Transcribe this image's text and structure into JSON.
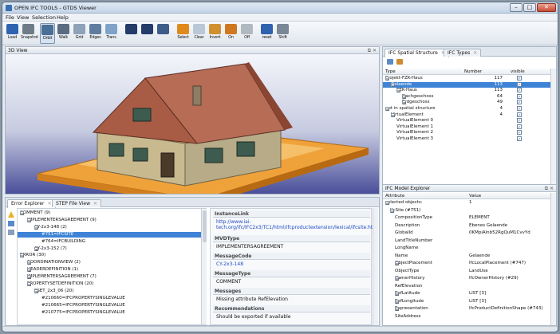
{
  "window": {
    "title": "OPEN IFC TOOLS - GTDS Viewer",
    "min_label": "–",
    "max_label": "□",
    "close_label": "✕"
  },
  "menu": [
    "File",
    "View",
    "Selection",
    "Help"
  ],
  "toolbar": [
    {
      "label": "Load",
      "icon": "folder-icon",
      "color": "#2f63b0"
    },
    {
      "label": "Snapshot",
      "icon": "camera-icon",
      "color": "#6f7b88"
    },
    {
      "label": "Orbit",
      "icon": "orbit-icon",
      "color": "#4a6f96",
      "active": true
    },
    {
      "label": "Walk",
      "icon": "walk-icon",
      "color": "#5a6c80"
    },
    {
      "label": "Grid",
      "icon": "grid-icon",
      "color": "#8ea2b8"
    },
    {
      "label": "Edges",
      "icon": "edges-icon",
      "color": "#5f7da0"
    },
    {
      "label": "Trans",
      "icon": "transparency-icon",
      "color": "#7fa2c9"
    },
    {
      "label": "",
      "icon": "points-icon",
      "color": "#243c6b"
    },
    {
      "label": "",
      "icon": "points-arrows-icon",
      "color": "#243c6b"
    },
    {
      "label": "",
      "icon": "tool-icon",
      "color": "#3d5c8a"
    },
    {
      "label": "Select",
      "icon": "select-icon",
      "color": "#e08a1c"
    },
    {
      "label": "Clear",
      "icon": "clear-icon",
      "color": "#b9c7d6"
    },
    {
      "label": "Invert",
      "icon": "invert-icon",
      "color": "#d09030"
    },
    {
      "label": "On",
      "icon": "on-icon",
      "color": "#d07820"
    },
    {
      "label": "Off",
      "icon": "off-icon",
      "color": "#b0b8c0"
    },
    {
      "label": "reset",
      "icon": "reset-icon",
      "color": "#2f63b0"
    },
    {
      "label": "Shift",
      "icon": "shift-icon",
      "color": "#7a8796"
    }
  ],
  "view3d": {
    "title": "3D View"
  },
  "spatial": {
    "tabs": [
      "IFC Spatial Structure",
      "IFC Types"
    ],
    "columns": [
      "Type",
      "Number",
      "visible"
    ],
    "rows": [
      {
        "label": "Projekt-FZK-Haus",
        "indent": 0,
        "exp": "⊟",
        "number": "117",
        "check": "✓"
      },
      {
        "label": "Gelaende",
        "indent": 1,
        "exp": "⊟",
        "number": "113",
        "check": "✓",
        "selected": true
      },
      {
        "label": "FZK-Haus",
        "indent": 2,
        "exp": "⊟",
        "number": "113",
        "check": "✓"
      },
      {
        "label": "Dachgeschoss",
        "indent": 3,
        "exp": "⊞",
        "number": "64",
        "check": "✓"
      },
      {
        "label": "Erdgeschoss",
        "indent": 3,
        "exp": "⊞",
        "number": "49",
        "check": "✓"
      },
      {
        "label": "not in spatial structure",
        "indent": 0,
        "exp": "⊟",
        "number": "4",
        "check": "✓"
      },
      {
        "label": "VirtualElement",
        "indent": 1,
        "exp": "⊟",
        "number": "4",
        "check": "✓"
      },
      {
        "label": "VirtualElement 0",
        "indent": 2,
        "exp": "",
        "number": "",
        "check": "✓"
      },
      {
        "label": "VirtualElement 1",
        "indent": 2,
        "exp": "",
        "number": "",
        "check": "✓"
      },
      {
        "label": "VirtualElement 2",
        "indent": 2,
        "exp": "",
        "number": "",
        "check": "✓"
      },
      {
        "label": "VirtualElement 3",
        "indent": 2,
        "exp": "",
        "number": "",
        "check": "✓"
      }
    ]
  },
  "errors": {
    "tabs": [
      "Error Explorer",
      "STEP File View"
    ],
    "rows": [
      {
        "label": "COMMENT (9)",
        "indent": 0,
        "exp": "⊟"
      },
      {
        "label": "IMPLEMENTERSAGREEMENT (9)",
        "indent": 1,
        "exp": "⊟"
      },
      {
        "label": "CY-2x3-148 (2)",
        "indent": 2,
        "exp": "⊟"
      },
      {
        "label": "#751=IFCSITE",
        "indent": 3,
        "exp": "",
        "selected": true
      },
      {
        "label": "#764=IFCBUILDING",
        "indent": 3,
        "exp": ""
      },
      {
        "label": "CY-2x3-152 (7)",
        "indent": 2,
        "exp": "⊞"
      },
      {
        "label": "ERROR (30)",
        "indent": 0,
        "exp": "⊟"
      },
      {
        "label": "COORDINATIONVIEW (2)",
        "indent": 1,
        "exp": "⊞"
      },
      {
        "label": "HEADERDEFINITION (1)",
        "indent": 1,
        "exp": "⊞"
      },
      {
        "label": "IMPLEMENTERSAGREEMENT (7)",
        "indent": 1,
        "exp": "⊞"
      },
      {
        "label": "PROPERTYSETDEFINITION (20)",
        "indent": 1,
        "exp": "⊟"
      },
      {
        "label": "PSET_2x3_06 (20)",
        "indent": 2,
        "exp": "⊟"
      },
      {
        "label": "#210660=IFCPROPERTYSINGLEVALUE",
        "indent": 3,
        "exp": ""
      },
      {
        "label": "#210665=IFCPROPERTYSINGLEVALUE",
        "indent": 3,
        "exp": ""
      },
      {
        "label": "#210775=IFCPROPERTYSINGLEVALUE",
        "indent": 3,
        "exp": ""
      }
    ],
    "details": [
      {
        "label": "InstanceLink",
        "value": "http://www.iai-tech.org/ifc/IFC2x3/TC1/html/ifcproductextension/lexical/ifcsite.htm",
        "link": true
      },
      {
        "label": "MVDType",
        "value": "IMPLEMENTERSAGREEMENT"
      },
      {
        "label": "MessageCode",
        "value": "CY-2x3-148",
        "link": true
      },
      {
        "label": "MessageType",
        "value": "COMMENT"
      },
      {
        "label": "Messages",
        "value": "Missing attribute RefElevation"
      },
      {
        "label": "Recommendations",
        "value": "Should be exported if available"
      }
    ]
  },
  "model": {
    "title": "IFC Model Explorer",
    "columns": [
      "Attribute",
      "Value"
    ],
    "rows": [
      {
        "attr": "selected objects:",
        "value": "1",
        "indent": 0,
        "exp": "⊟"
      },
      {
        "attr": "IfcSite (#751)",
        "value": "",
        "indent": 1,
        "exp": "⊟"
      },
      {
        "attr": "CompositionType",
        "value": "ELEMENT",
        "indent": 2,
        "exp": ""
      },
      {
        "attr": "Description",
        "value": "Ebenes Gelaende",
        "indent": 2,
        "exp": ""
      },
      {
        "attr": "GlobalId",
        "value": "0KMpiAlnb52RgQuM1CvvYd",
        "indent": 2,
        "exp": ""
      },
      {
        "attr": "LandTitleNumber",
        "value": "",
        "indent": 2,
        "exp": ""
      },
      {
        "attr": "LongName",
        "value": "",
        "indent": 2,
        "exp": ""
      },
      {
        "attr": "Name",
        "value": "Gelaende",
        "indent": 2,
        "exp": ""
      },
      {
        "attr": "ObjectPlacement",
        "value": "IfcLocalPlacement (#747)",
        "indent": 2,
        "exp": "⊞"
      },
      {
        "attr": "ObjectType",
        "value": "LandUse",
        "indent": 2,
        "exp": ""
      },
      {
        "attr": "OwnerHistory",
        "value": "IfcOwnerHistory (#29)",
        "indent": 2,
        "exp": "⊞"
      },
      {
        "attr": "RefElevation",
        "value": "",
        "indent": 2,
        "exp": ""
      },
      {
        "attr": "RefLatitude",
        "value": "LIST [3]",
        "indent": 2,
        "exp": "⊞"
      },
      {
        "attr": "RefLongitude",
        "value": "LIST [3]",
        "indent": 2,
        "exp": "⊞"
      },
      {
        "attr": "Representation",
        "value": "IfcProductDefinitionShape (#743)",
        "indent": 2,
        "exp": "⊞"
      },
      {
        "attr": "SiteAddress",
        "value": "",
        "indent": 2,
        "exp": ""
      }
    ]
  }
}
